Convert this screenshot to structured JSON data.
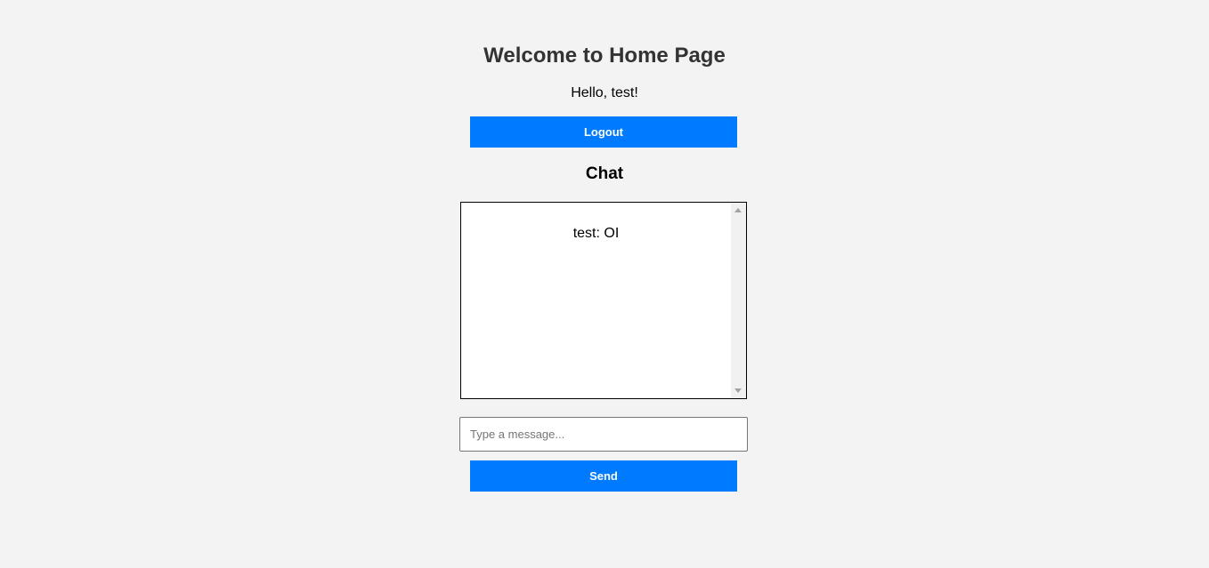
{
  "page": {
    "title": "Welcome to Home Page",
    "greeting": "Hello, test!"
  },
  "buttons": {
    "logout_label": "Logout",
    "send_label": "Send"
  },
  "chat": {
    "heading": "Chat",
    "messages": [
      {
        "text": "test: OI"
      }
    ],
    "input": {
      "value": "",
      "placeholder": "Type a message..."
    }
  },
  "colors": {
    "accent": "#007bff",
    "background": "#f3f3f3",
    "title_text": "#333333"
  }
}
